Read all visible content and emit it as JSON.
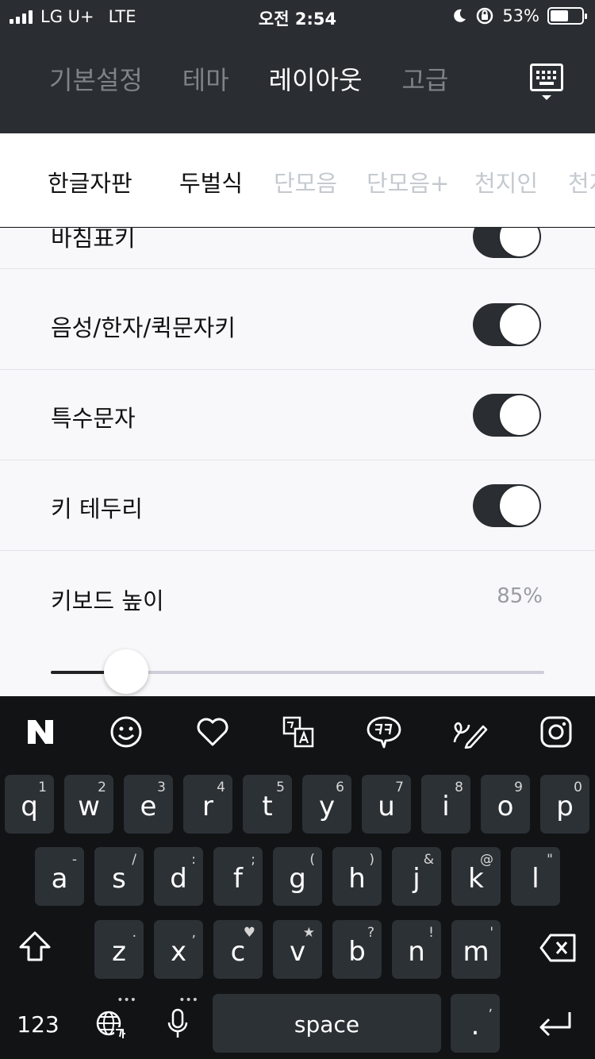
{
  "status_bar": {
    "carrier": "LG U+",
    "network": "LTE",
    "time": "오전 2:54",
    "battery": "53%",
    "battery_level": 0.53
  },
  "header": {
    "tabs": [
      "기본설정",
      "테마",
      "레이아웃",
      "고급"
    ],
    "active_tab": 2,
    "keyboard_icon": "keyboard-icon"
  },
  "subtabs": [
    "한글자판",
    "두벌식",
    "단모음",
    "단모음+",
    "천지인",
    "천지"
  ],
  "settings": {
    "partial_label": "바침표키",
    "rows": [
      {
        "label": "음성/한자/퀵문자키",
        "on": true
      },
      {
        "label": "특수문자",
        "on": true
      },
      {
        "label": "키 테두리",
        "on": true
      }
    ],
    "height": {
      "label": "키보드 높이",
      "value": "85%",
      "slider_level": 0.14
    }
  },
  "keyboard": {
    "toolbar": [
      "naver-icon",
      "emoji-icon",
      "heart-icon",
      "translate-icon",
      "kk-chat-icon",
      "handwriting-icon",
      "instagram-icon"
    ],
    "row1": [
      {
        "k": "q",
        "s": "1"
      },
      {
        "k": "w",
        "s": "2"
      },
      {
        "k": "e",
        "s": "3"
      },
      {
        "k": "r",
        "s": "4"
      },
      {
        "k": "t",
        "s": "5"
      },
      {
        "k": "y",
        "s": "6"
      },
      {
        "k": "u",
        "s": "7"
      },
      {
        "k": "i",
        "s": "8"
      },
      {
        "k": "o",
        "s": "9"
      },
      {
        "k": "p",
        "s": "0"
      }
    ],
    "row2": [
      {
        "k": "a",
        "s": "-"
      },
      {
        "k": "s",
        "s": "/"
      },
      {
        "k": "d",
        "s": ":"
      },
      {
        "k": "f",
        "s": ";"
      },
      {
        "k": "g",
        "s": "("
      },
      {
        "k": "h",
        "s": ")"
      },
      {
        "k": "j",
        "s": "&"
      },
      {
        "k": "k",
        "s": "@"
      },
      {
        "k": "l",
        "s": "\""
      }
    ],
    "row3": [
      {
        "k": "z",
        "s": "."
      },
      {
        "k": "x",
        "s": ","
      },
      {
        "k": "c",
        "s": "♥"
      },
      {
        "k": "v",
        "s": "★"
      },
      {
        "k": "b",
        "s": "?"
      },
      {
        "k": "n",
        "s": "!"
      },
      {
        "k": "m",
        "s": "'"
      }
    ],
    "numbers_label": "123",
    "space_label": "space",
    "period_label": ".",
    "period_sub": ","
  }
}
